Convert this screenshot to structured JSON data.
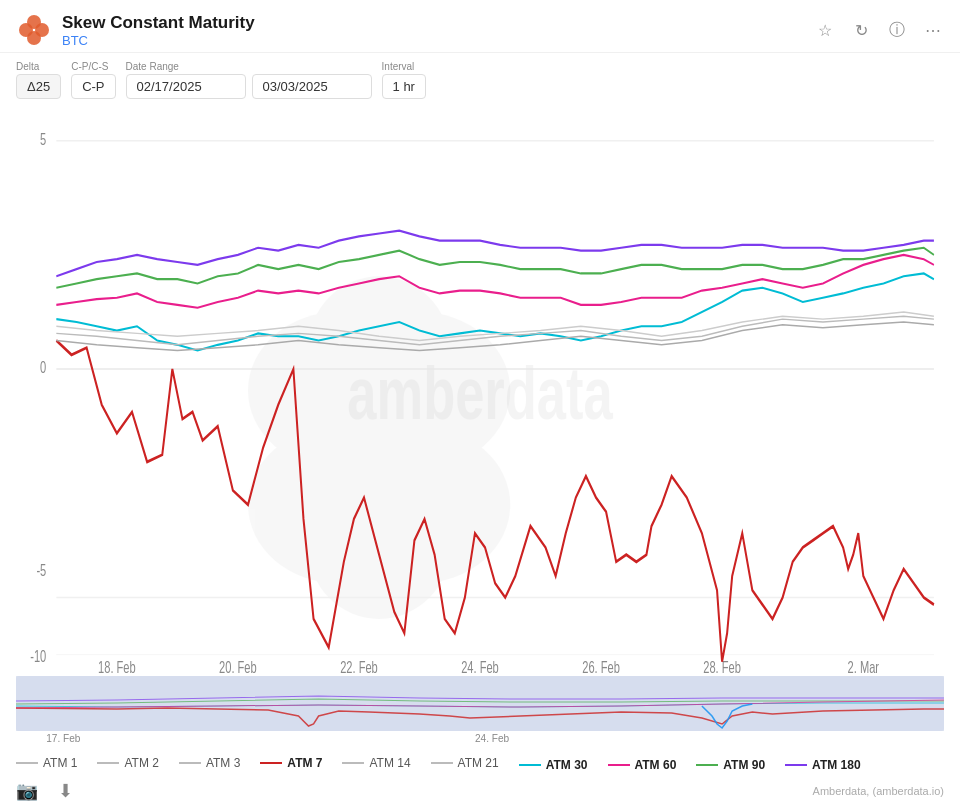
{
  "header": {
    "title": "Skew Constant Maturity",
    "subtitle": "BTC"
  },
  "controls": {
    "delta_label": "Delta",
    "delta_value": "Δ25",
    "cp_label": "C-P/C-S",
    "cp_value": "C-P",
    "date_range_label": "Date Range",
    "date_start": "02/17/2025",
    "date_end": "03/03/2025",
    "interval_label": "Interval",
    "interval_value": "1 hr"
  },
  "chart": {
    "y_max": 5,
    "y_mid": 0,
    "y_min": -10,
    "x_labels": [
      "18. Feb",
      "20. Feb",
      "22. Feb",
      "24. Feb",
      "26. Feb",
      "28. Feb",
      "2. Mar"
    ],
    "mini_x_labels": [
      "17. Feb",
      "24. Feb"
    ]
  },
  "legend": {
    "row1": [
      {
        "id": "atm1",
        "label": "ATM 1",
        "color": "#bbb",
        "bold": false
      },
      {
        "id": "atm2",
        "label": "ATM 2",
        "color": "#bbb",
        "bold": false
      },
      {
        "id": "atm3",
        "label": "ATM 3",
        "color": "#bbb",
        "bold": false
      },
      {
        "id": "atm7",
        "label": "ATM 7",
        "color": "#cc1111",
        "bold": true
      },
      {
        "id": "atm14",
        "label": "ATM 14",
        "color": "#bbb",
        "bold": false
      },
      {
        "id": "atm21",
        "label": "ATM 21",
        "color": "#bbb",
        "bold": false
      }
    ],
    "row2": [
      {
        "id": "atm30",
        "label": "ATM 30",
        "color": "#00bcd4",
        "bold": true
      },
      {
        "id": "atm60",
        "label": "ATM 60",
        "color": "#e91e8c",
        "bold": true
      },
      {
        "id": "atm90",
        "label": "ATM 90",
        "color": "#4caf50",
        "bold": true
      },
      {
        "id": "atm180",
        "label": "ATM 180",
        "color": "#7c3aed",
        "bold": true
      }
    ]
  },
  "footer": {
    "attribution": "Amberdata, (amberdata.io)"
  },
  "icons": {
    "bookmark": "☆",
    "refresh": "↻",
    "info": "ⓘ",
    "menu": "⋯",
    "camera": "📷",
    "download": "⬇"
  }
}
